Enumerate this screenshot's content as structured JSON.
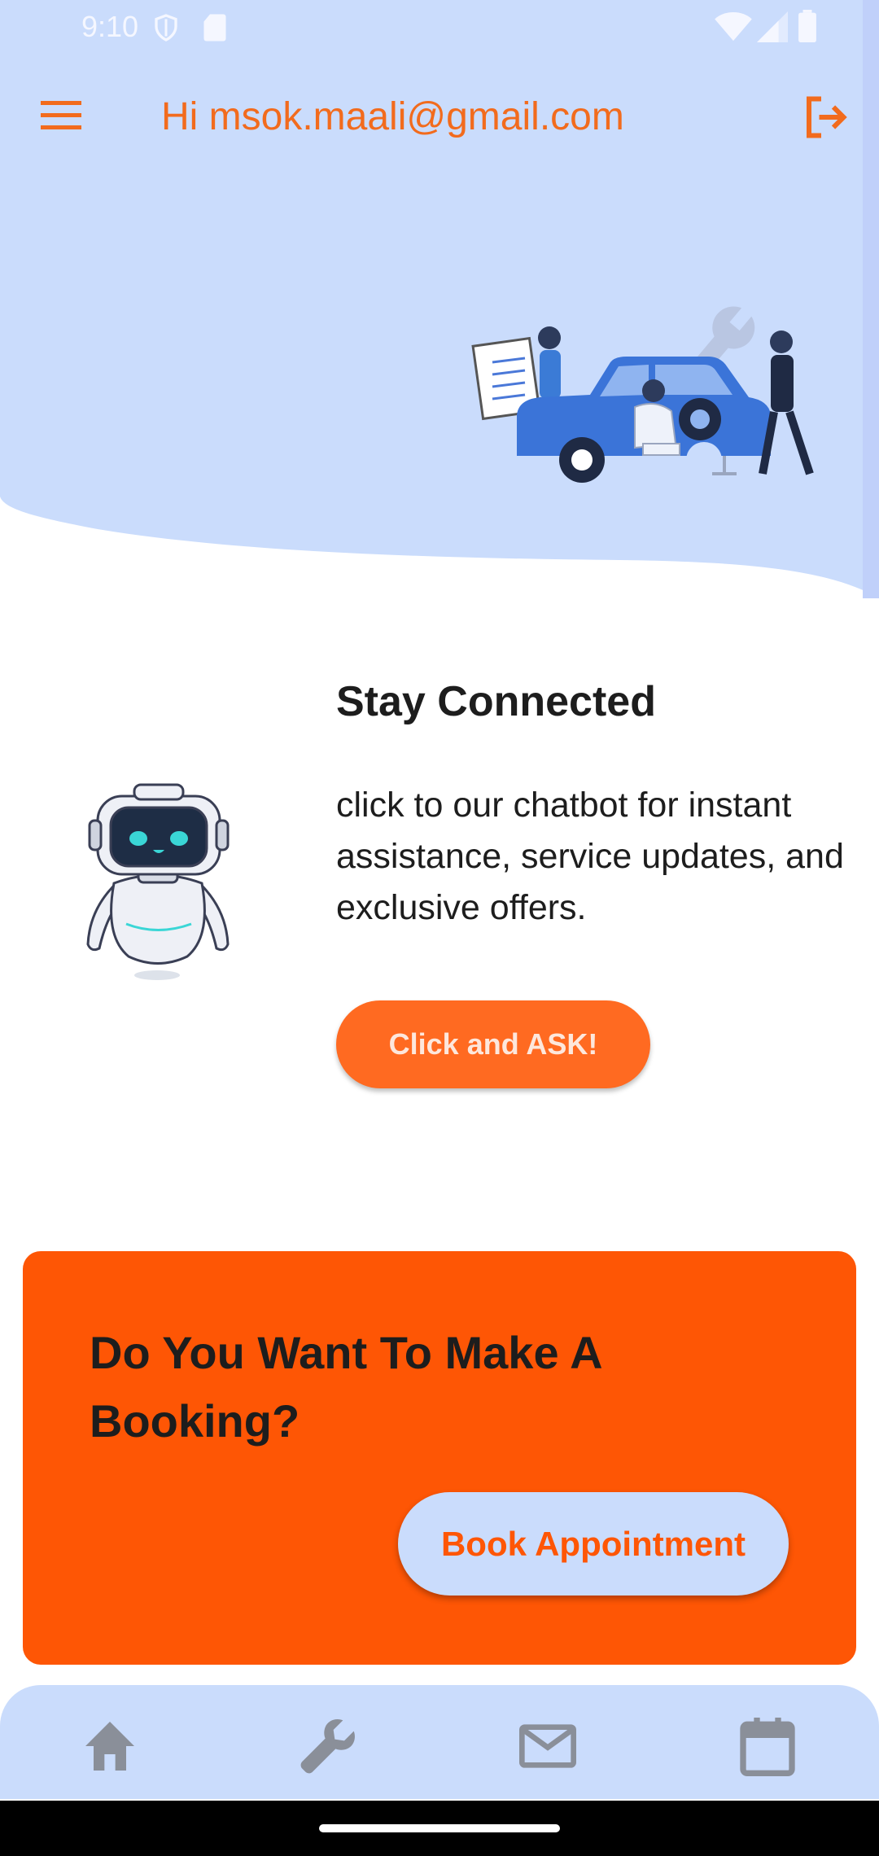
{
  "status_bar": {
    "time": "9:10"
  },
  "header": {
    "greeting": "Hi msok.maali@gmail.com"
  },
  "chat_card": {
    "title": "Stay Connected",
    "description": "click to our chatbot for instant assistance, service updates, and exclusive offers.",
    "button_label": "Click and ASK!"
  },
  "booking_card": {
    "title": "Do You Want To Make A Booking?",
    "button_label": "Book Appointment"
  },
  "bottom_nav": {
    "items": [
      {
        "icon": "home-icon"
      },
      {
        "icon": "wrench-icon"
      },
      {
        "icon": "mail-icon"
      },
      {
        "icon": "calendar-icon"
      }
    ]
  },
  "colors": {
    "accent_orange": "#fe5605",
    "button_orange": "#ff6a21",
    "header_text": "#f26b1d",
    "light_blue": "#cadcfc"
  }
}
